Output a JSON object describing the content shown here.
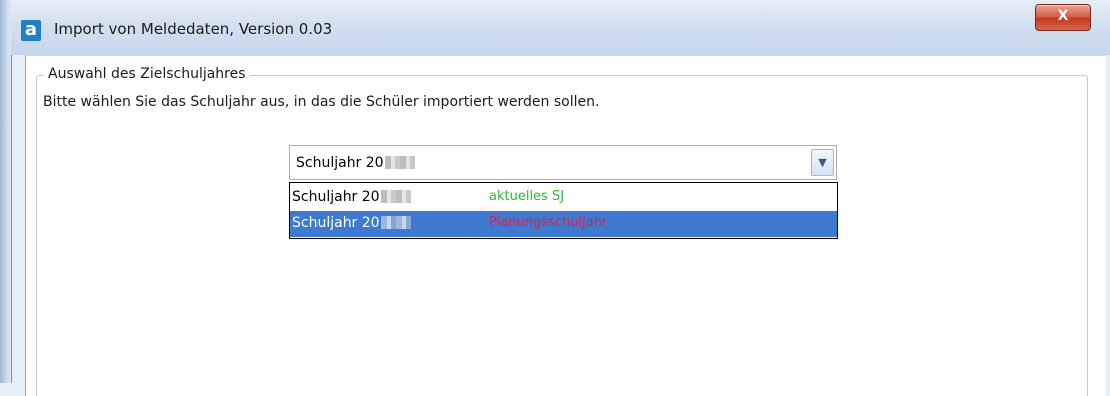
{
  "window": {
    "title": "Import von Meldedaten, Version 0.03",
    "close_glyph": "X",
    "app_icon_letter": "a"
  },
  "group": {
    "title": "Auswahl des Zielschuljahres",
    "instruction": "Bitte wählen Sie das Schuljahr aus, in das die Schüler importiert werden sollen."
  },
  "combo": {
    "selected_label": "Schuljahr 20",
    "arrow_icon": "chevron-down-icon"
  },
  "options": [
    {
      "label": "Schuljahr 20",
      "note": "aktuelles SJ",
      "note_color": "#2db82d",
      "selected": false
    },
    {
      "label": "Schuljahr 20",
      "note": "Planungsschuljahr",
      "note_color": "#e0204a",
      "selected": true
    }
  ],
  "colors": {
    "selection_highlight": "#3e7bd0",
    "close_button": "#c23a22"
  }
}
